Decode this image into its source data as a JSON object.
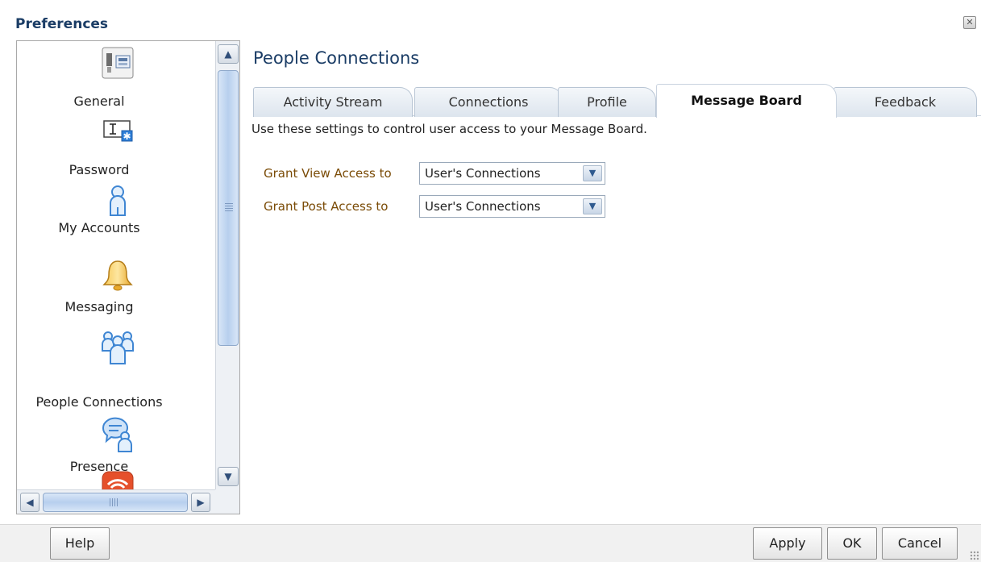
{
  "dialog": {
    "title": "Preferences",
    "close_label": "✕"
  },
  "nav": {
    "items": [
      {
        "label": "General",
        "icon": "general-icon"
      },
      {
        "label": "Password",
        "icon": "password-icon"
      },
      {
        "label": "My Accounts",
        "icon": "my-accounts-icon"
      },
      {
        "label": "Messaging",
        "icon": "bell-icon"
      },
      {
        "label": "People Connections",
        "icon": "people-connections-icon"
      },
      {
        "label": "Presence",
        "icon": "presence-icon"
      },
      {
        "label": "",
        "icon": "feed-icon"
      }
    ],
    "scroll_up": "▲",
    "scroll_down": "▼",
    "scroll_left": "◀",
    "scroll_right": "▶"
  },
  "main": {
    "title": "People Connections",
    "tabs": [
      {
        "label": "Activity Stream",
        "active": false
      },
      {
        "label": "Connections",
        "active": false
      },
      {
        "label": "Profile",
        "active": false
      },
      {
        "label": "Message Board",
        "active": true
      },
      {
        "label": "Feedback",
        "active": false
      }
    ],
    "description": "Use these settings to control user access to your Message Board.",
    "fields": [
      {
        "label": "Grant View Access to",
        "value": "User's Connections"
      },
      {
        "label": "Grant Post Access to",
        "value": "User's Connections"
      }
    ]
  },
  "footer": {
    "help_label": "Help",
    "apply_label": "Apply",
    "ok_label": "OK",
    "cancel_label": "Cancel"
  },
  "colors": {
    "title": "#1b3d66",
    "field_label": "#7a4b06",
    "icon_blue": "#4a8fd6"
  }
}
